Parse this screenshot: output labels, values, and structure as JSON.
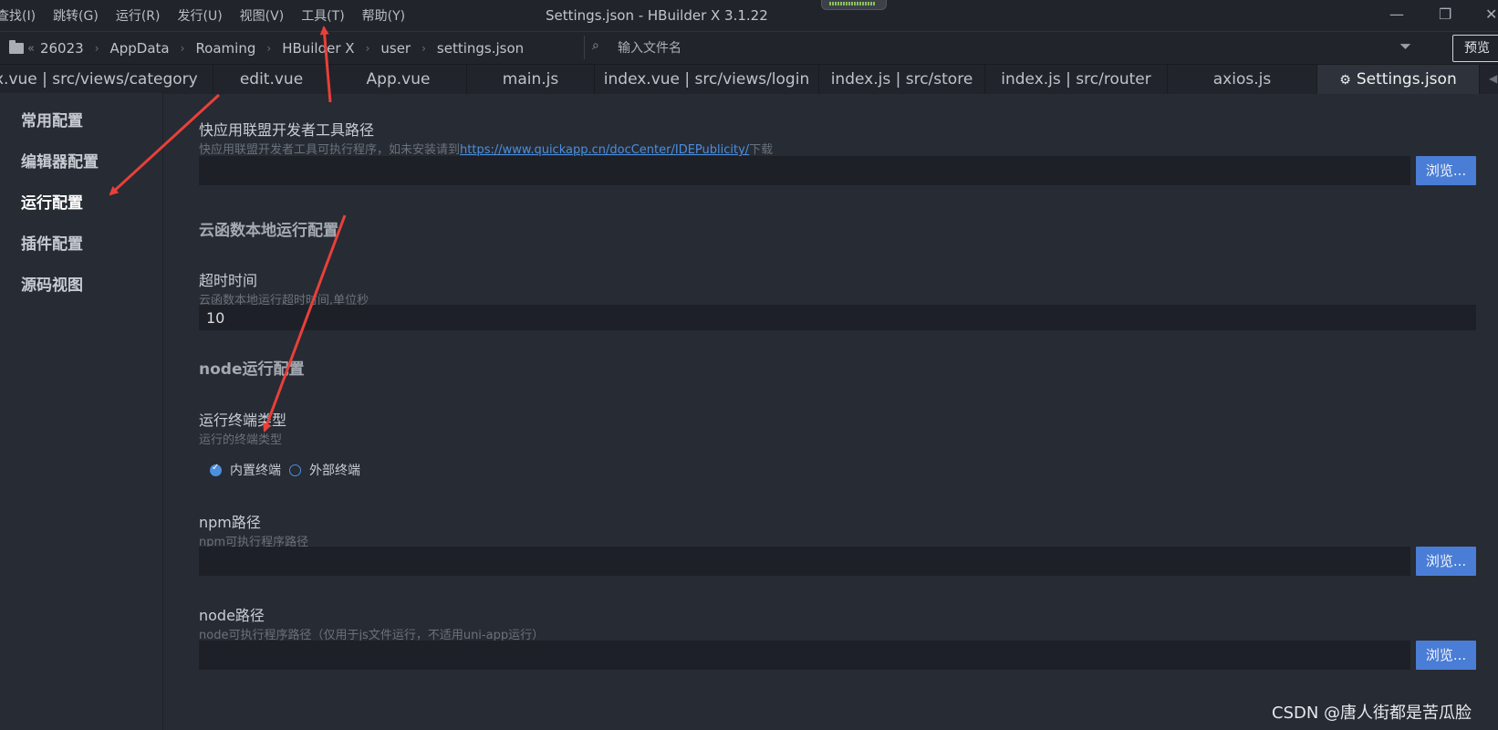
{
  "menu": [
    "查找(I)",
    "跳转(G)",
    "运行(R)",
    "发行(U)",
    "视图(V)",
    "工具(T)",
    "帮助(Y)"
  ],
  "window_title": "Settings.json - HBuilder X 3.1.22",
  "window_controls": {
    "minimize": "—",
    "restore": "❐",
    "close": "✕"
  },
  "breadcrumb": {
    "overflow": "«",
    "items": [
      "26023",
      "AppData",
      "Roaming",
      "HBuilder X",
      "user",
      "settings.json"
    ]
  },
  "file_search": {
    "placeholder": "输入文件名"
  },
  "preview_label": "预览",
  "tabs": [
    "x.vue | src/views/category",
    "edit.vue",
    "App.vue",
    "main.js",
    "index.vue | src/views/login",
    "index.js | src/store",
    "index.js | src/router",
    "axios.js",
    "Settings.json"
  ],
  "active_tab": "Settings.json",
  "sidebar": [
    "常用配置",
    "编辑器配置",
    "运行配置",
    "插件配置",
    "源码视图"
  ],
  "active_sidebar": "运行配置",
  "settings": {
    "quickapp": {
      "label": "快应用联盟开发者工具路径",
      "hint_before": "快应用联盟开发者工具可执行程序，如未安装请到",
      "hint_link": "https://www.quickapp.cn/docCenter/IDEPublicity/",
      "hint_after": "下载",
      "value": "",
      "browse": "浏览..."
    },
    "cloud_section": "云函数本地运行配置",
    "timeout": {
      "label": "超时时间",
      "hint": "云函数本地运行超时时间,单位秒",
      "value": "10"
    },
    "node_section": "node运行配置",
    "terminal": {
      "label": "运行终端类型",
      "hint": "运行的终端类型",
      "options": [
        "内置终端",
        "外部终端"
      ],
      "selected": "内置终端"
    },
    "npm": {
      "label": "npm路径",
      "hint": "npm可执行程序路径",
      "value": "",
      "browse": "浏览..."
    },
    "node": {
      "label": "node路径",
      "hint": "node可执行程序路径（仅用于js文件运行，不适用uni-app运行）",
      "value": "",
      "browse": "浏览..."
    }
  },
  "watermark": "CSDN @唐人街都是苦瓜脸",
  "colors": {
    "accent": "#4a7dd6",
    "link": "#4a8fe0",
    "annotation_arrow": "#e8403a",
    "background": "#272b33"
  }
}
